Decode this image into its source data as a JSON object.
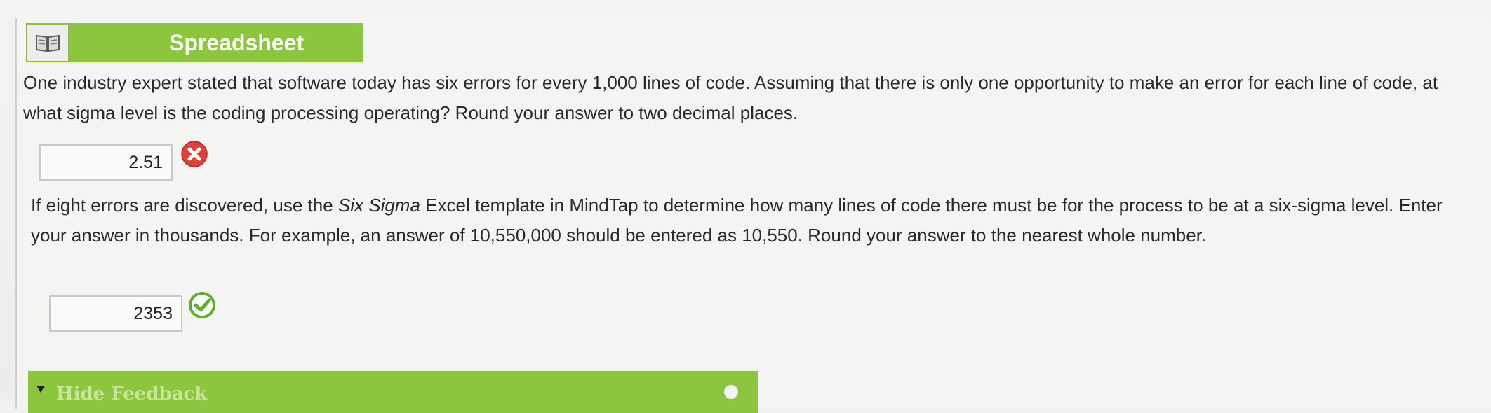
{
  "header": {
    "title": "Spreadsheet",
    "icon": "book-icon"
  },
  "question1": {
    "text": "One industry expert stated that software today has six errors for every 1,000 lines of code. Assuming that there is only one opportunity to make an error for each line of code, at what sigma level is the coding processing operating? Round your answer to two decimal places.",
    "answer": "2.51",
    "status": "incorrect",
    "status_icon": "x-circle-icon",
    "status_color": "#e0403a"
  },
  "question2": {
    "text_before": "If eight errors are discovered, use the ",
    "text_italic": "Six Sigma",
    "text_after": " Excel template in MindTap to determine how many lines of code there must be for the process to be at a six-sigma level. Enter your answer in thousands. For example, an answer of 10,550,000 should be entered as 10,550. Round your answer to the nearest whole number.",
    "answer": "2353",
    "status": "correct",
    "status_icon": "check-circle-icon",
    "status_color": "#5fae2e"
  },
  "feedback": {
    "label": "Hide Feedback",
    "toggle_icon": "triangle-down-icon"
  },
  "colors": {
    "accent": "#8cc63f",
    "background": "#f1f1ef"
  }
}
